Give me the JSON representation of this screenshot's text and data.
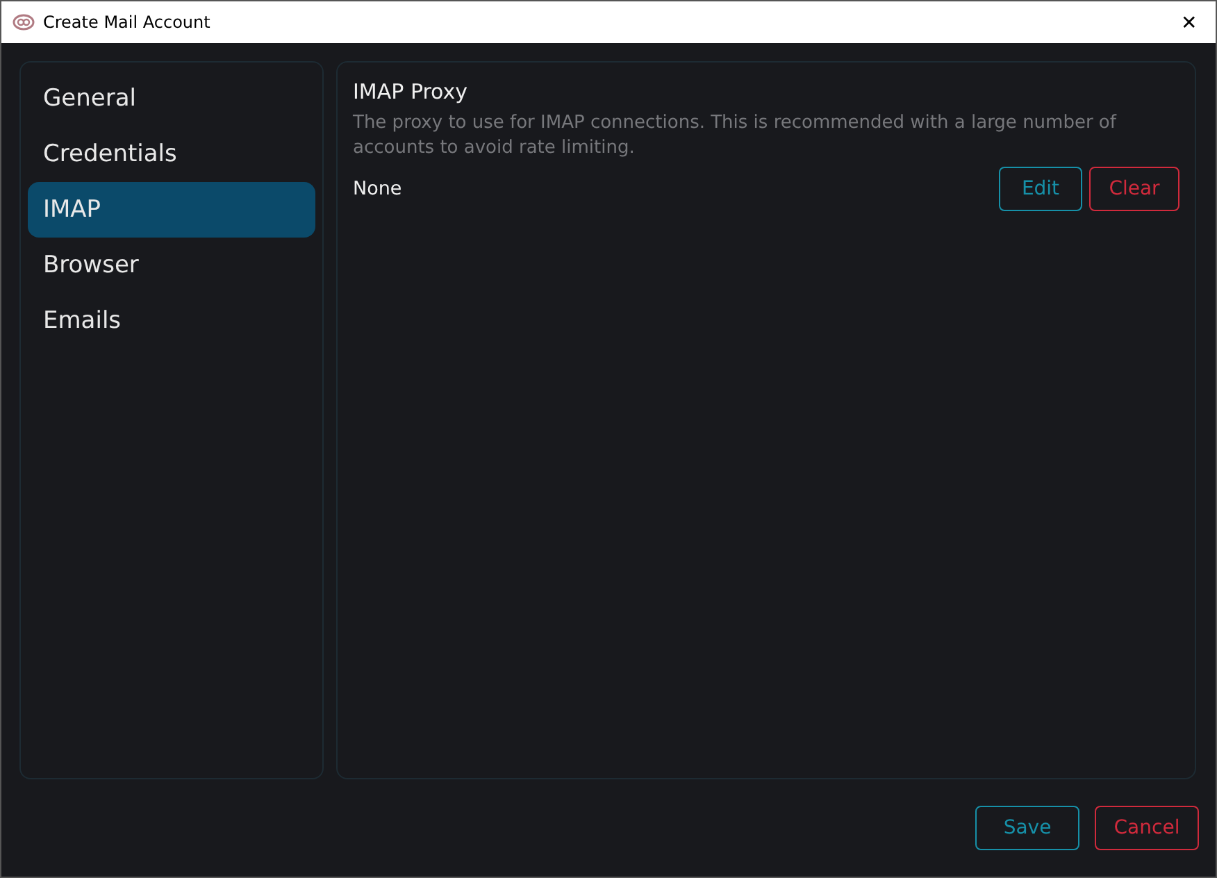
{
  "window": {
    "title": "Create Mail Account",
    "close": "✕"
  },
  "sidebar": {
    "items": [
      {
        "label": "General",
        "selected": false
      },
      {
        "label": "Credentials",
        "selected": false
      },
      {
        "label": "IMAP",
        "selected": true
      },
      {
        "label": "Browser",
        "selected": false
      },
      {
        "label": "Emails",
        "selected": false
      }
    ]
  },
  "section": {
    "title": "IMAP Proxy",
    "description": "The proxy to use for IMAP connections. This is recommended with a large number of accounts to avoid rate limiting.",
    "value": "None",
    "buttons": [
      {
        "label": "Edit",
        "kind": "primary"
      },
      {
        "label": "Clear",
        "kind": "danger"
      }
    ]
  },
  "footer": {
    "buttons": [
      {
        "label": "Save",
        "kind": "primary"
      },
      {
        "label": "Cancel",
        "kind": "danger"
      }
    ]
  }
}
